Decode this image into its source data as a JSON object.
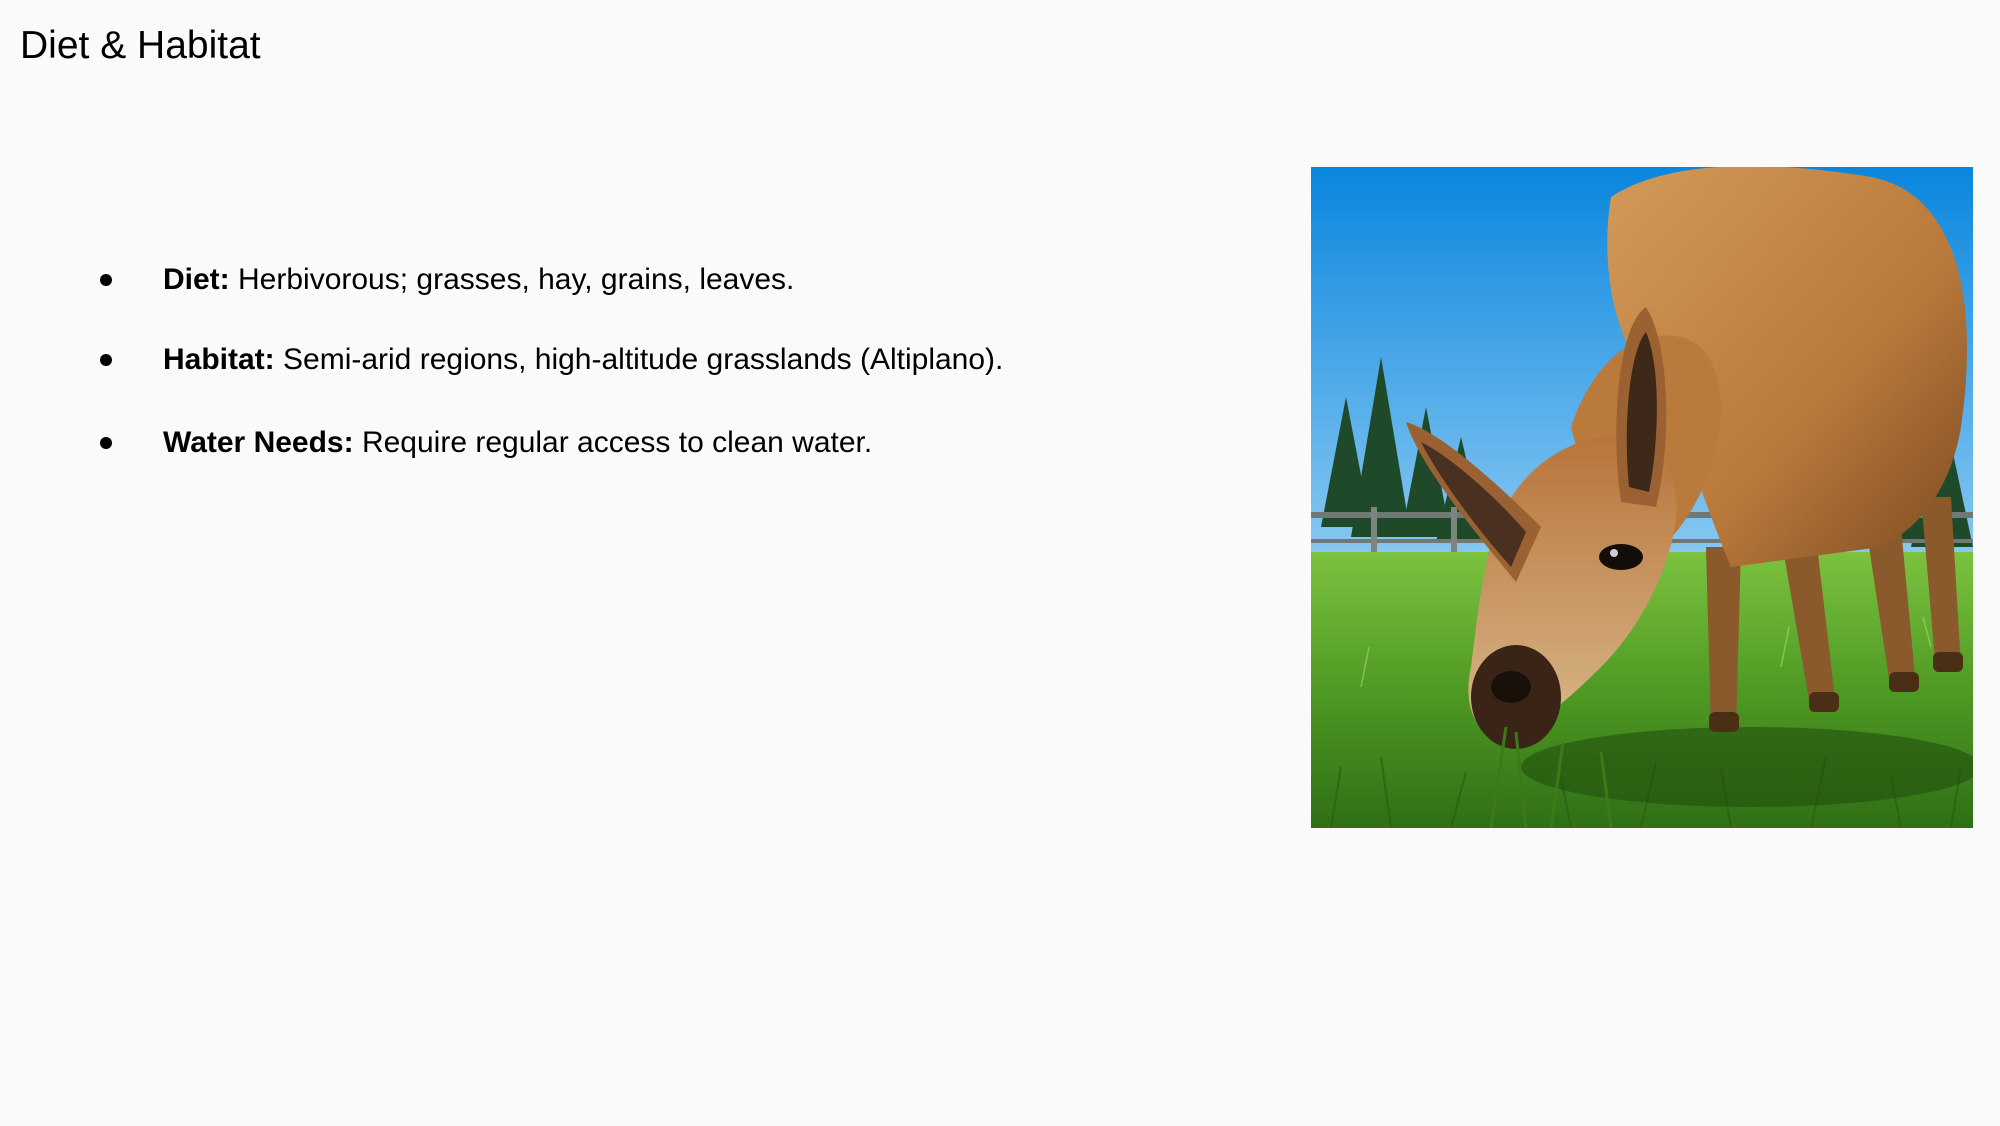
{
  "slide": {
    "title": "Diet & Habitat",
    "bullets": [
      {
        "term": "Diet:",
        "text": " Herbivorous; grasses, hay, grains, leaves."
      },
      {
        "term": "Habitat:",
        "text": " Semi-arid regions, high-altitude grasslands (Altiplano)."
      },
      {
        "term": "Water Needs:",
        "text": " Require regular access to clean water."
      }
    ],
    "image": {
      "subject": "grazing-llama-photo"
    }
  },
  "colors": {
    "background": "#fafafa",
    "text": "#000000",
    "sky": "#1a8ee0",
    "grass": "#4f9a24",
    "fur": "#b8783a"
  }
}
